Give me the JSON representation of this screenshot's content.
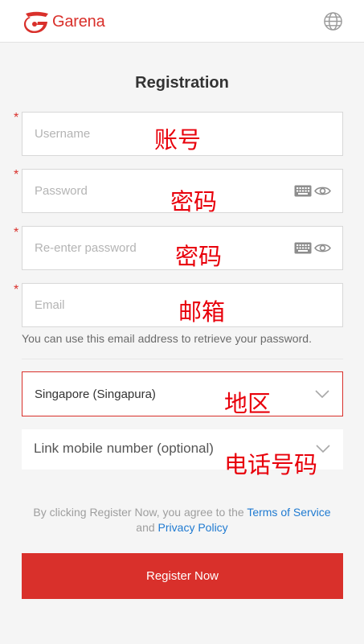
{
  "header": {
    "brand": "Garena",
    "brand_color": "#d9302b",
    "logo_icon": "garena-logo-icon",
    "language_icon": "globe-icon"
  },
  "title": "Registration",
  "form": {
    "username": {
      "placeholder": "Username",
      "value": "",
      "required_mark": "*",
      "annotation": "账号"
    },
    "password": {
      "placeholder": "Password",
      "value": "",
      "required_mark": "*",
      "annotation": "密码"
    },
    "repassword": {
      "placeholder": "Re-enter password",
      "value": "",
      "required_mark": "*",
      "annotation": "密码"
    },
    "email": {
      "placeholder": "Email",
      "value": "",
      "required_mark": "*",
      "annotation": "邮箱"
    },
    "email_hint": "You can use this email address to retrieve your password.",
    "region": {
      "selected": "Singapore (Singapura)",
      "annotation": "地区"
    },
    "mobile": {
      "label": "Link mobile number (optional)",
      "annotation": "电话号码"
    }
  },
  "terms": {
    "prefix": "By clicking Register Now, you agree to the",
    "tos_link": "Terms of Service",
    "and": "and",
    "privacy_link": "Privacy Policy",
    "link_color": "#1f7ad1"
  },
  "register_button": "Register Now",
  "annotation_color": "#e8000b"
}
